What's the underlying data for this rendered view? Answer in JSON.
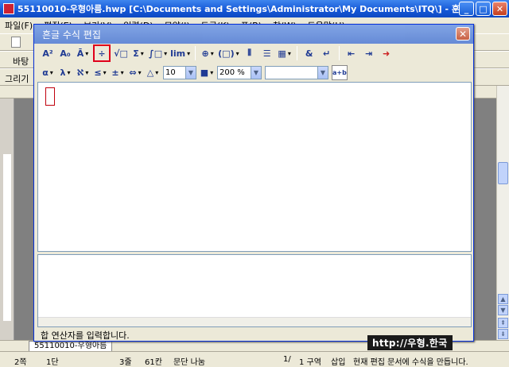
{
  "main_window": {
    "title": "55110010-우형아름.hwp [C:\\Documents and Settings\\Administrator\\My Documents\\ITQ\\] - 훈글"
  },
  "menu": [
    "파일(F)",
    "편집(E)",
    "보기(V)",
    "입력(D)",
    "모양(J)",
    "도구(K)",
    "표(B)",
    "창(W)",
    "도움말(H)"
  ],
  "toolbar_labels": {
    "row2": "바탕",
    "row3": "그리기"
  },
  "equation_dialog": {
    "title": "흔글 수식 편집",
    "status_text": "합 연산자를 입력합니다.",
    "font_size": "10",
    "zoom": "200 %",
    "font_name": ""
  },
  "doc_tab": "55110010-우형아름",
  "status_bar": {
    "page": "2쪽",
    "section": "1단",
    "line": "3줄",
    "column": "61칸",
    "break": "문단 나눔",
    "page_of": "1/",
    "zone": "1 구역",
    "mode": "삽입",
    "message": "현재 편집 문서에 수식을 만듭니다."
  },
  "watermark": "http://우형.한국",
  "icons": {
    "toolbar1": [
      "superscript-icon",
      "subscript-icon",
      "decoration-icon",
      "fraction-icon",
      "root-icon",
      "sum-icon",
      "integral-icon",
      "limit-icon",
      "brackets-icon",
      "paren-icon",
      "matrix-icon",
      "column-vector-icon",
      "grid-matrix-icon",
      "ampersand-icon",
      "newline-icon",
      "align-left-icon",
      "align-right-icon",
      "insert-equation-icon"
    ],
    "toolbar2": [
      "greek-alpha-icon",
      "greek-lambda-icon",
      "greek-aleph-icon",
      "relation-icon",
      "plus-minus-icon",
      "arrow-icon",
      "triangle-icon"
    ]
  }
}
